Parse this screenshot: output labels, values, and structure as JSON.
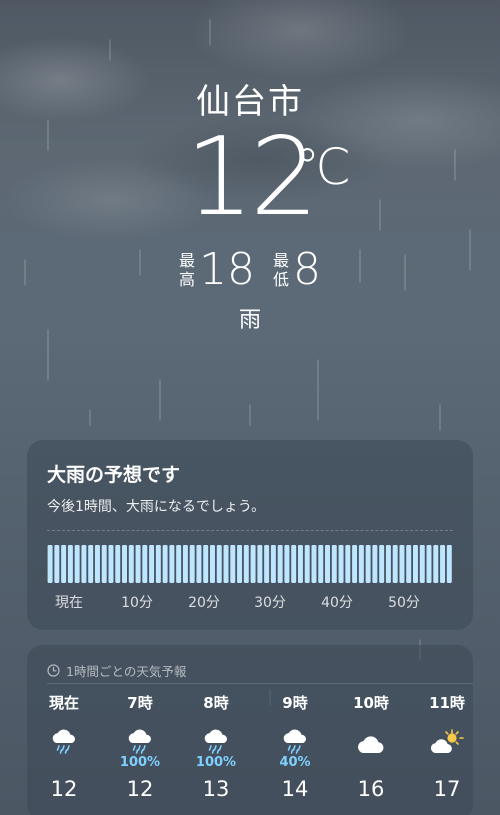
{
  "location": {
    "city": "仙台市"
  },
  "current": {
    "temperature": "12",
    "unit": "℃",
    "high_label": [
      "最",
      "高"
    ],
    "high": "18",
    "low_label": [
      "最",
      "低"
    ],
    "low": "8",
    "condition": "雨"
  },
  "precipitation_card": {
    "title": "大雨の予想です",
    "subtitle": "今後1時間、大雨になるでしょう。",
    "ticks": [
      "現在",
      "10分",
      "20分",
      "30分",
      "40分",
      "50分"
    ],
    "intensity_minutes": 60
  },
  "hourly_card": {
    "header": "1時間ごとの天気予報",
    "hours": [
      {
        "label": "現在",
        "icon": "rain-cloud-icon",
        "probability": "",
        "temp": "12"
      },
      {
        "label": "7時",
        "icon": "rain-cloud-icon",
        "probability": "100%",
        "temp": "12"
      },
      {
        "label": "8時",
        "icon": "rain-cloud-icon",
        "probability": "100%",
        "temp": "13"
      },
      {
        "label": "9時",
        "icon": "rain-cloud-icon",
        "probability": "40%",
        "temp": "14"
      },
      {
        "label": "10時",
        "icon": "cloud-icon",
        "probability": "",
        "temp": "16"
      },
      {
        "label": "11時",
        "icon": "partly-sunny-icon",
        "probability": "",
        "temp": "17"
      }
    ]
  },
  "colors": {
    "rain_bar": "#bfe6ff",
    "probability": "#7fd0ff",
    "sun": "#f7c948"
  }
}
